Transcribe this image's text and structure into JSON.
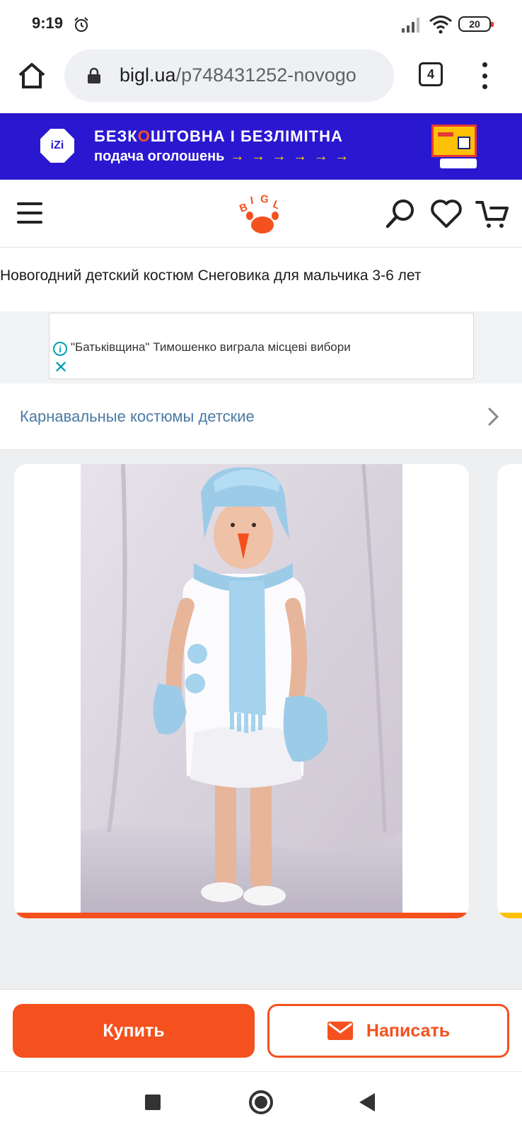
{
  "status_bar": {
    "time": "9:19",
    "battery": "20",
    "icons": [
      "alarm-icon",
      "signal-icon",
      "wifi-icon",
      "battery-icon"
    ]
  },
  "browser": {
    "url_domain": "bigl.ua",
    "url_path": "/p748431252-novogo",
    "tab_count": "4",
    "icons": [
      "home-icon",
      "lock-icon",
      "tabs-icon",
      "kebab-menu-icon"
    ]
  },
  "promo": {
    "line1_a": "БЕЗК",
    "line1_o": "О",
    "line1_b": "ШТОВНА І БЕЗЛІМІТНА",
    "line2": "подача оголошень",
    "arrows": "→ → → → → →",
    "logo": "iZi",
    "colors": {
      "background": "#2a18d0",
      "accent": "#f4511e",
      "arrows": "#ffd600"
    }
  },
  "header": {
    "logo_text": "BIGL",
    "icons": [
      "menu-icon",
      "search-icon",
      "heart-icon",
      "cart-icon"
    ],
    "brand_color": "#f4511e"
  },
  "product": {
    "title": "Новогодний детский костюм Снеговика для мальчика 3-6 лет"
  },
  "ad": {
    "text": "\"Батьківщина\" Тимошенко виграла місцеві вибори",
    "info": "i",
    "close": "✕"
  },
  "breadcrumb": {
    "label": "Карнавальные костюмы детские"
  },
  "actions": {
    "buy_label": "Купить",
    "write_label": "Написать"
  },
  "nav": {
    "icons": [
      "recent-apps-icon",
      "home-circle-icon",
      "back-icon"
    ]
  }
}
